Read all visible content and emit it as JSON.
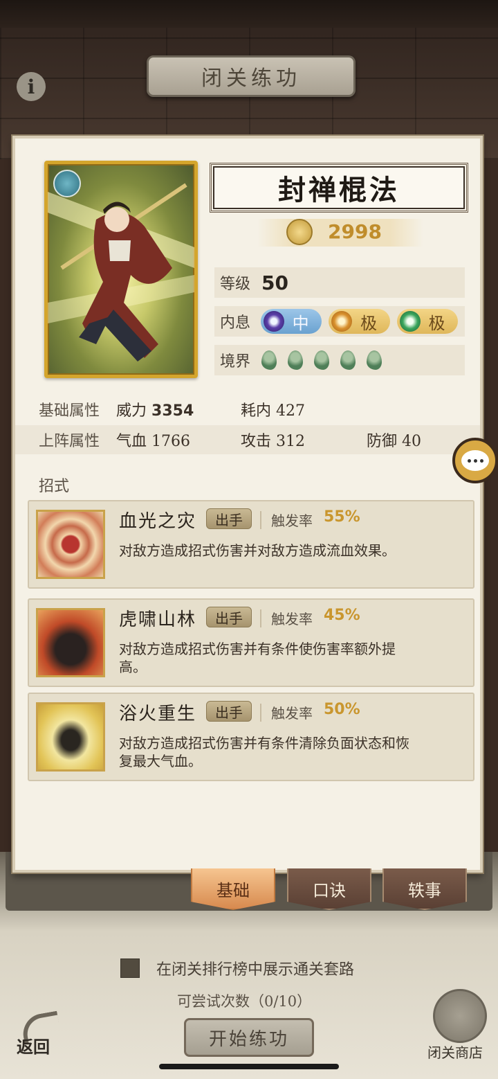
{
  "header": {
    "title": "闭关练功"
  },
  "skill_card": {
    "name": "封禅棍法",
    "power": "2998",
    "level_label": "等级",
    "level_value": "50",
    "inner_label": "内息",
    "inner_pills": [
      "中",
      "极",
      "极"
    ],
    "realm_label": "境界",
    "realm_count": 5
  },
  "attributes": {
    "base_label": "基础属性",
    "base": [
      {
        "key": "威力",
        "value": "3354"
      },
      {
        "key": "耗内",
        "value": "427"
      }
    ],
    "battle_label": "上阵属性",
    "battle": [
      {
        "key": "气血",
        "value": "1766"
      },
      {
        "key": "攻击",
        "value": "312"
      },
      {
        "key": "防御",
        "value": "40"
      }
    ]
  },
  "moves_label": "招式",
  "moves": [
    {
      "name": "血光之灾",
      "tag": "出手",
      "rate_label": "触发率",
      "rate": "55%",
      "desc": "对敌方造成招式伤害并对敌方造成流血效果。"
    },
    {
      "name": "虎啸山林",
      "tag": "出手",
      "rate_label": "触发率",
      "rate": "45%",
      "desc": "对敌方造成招式伤害并有条件使伤害率额外提高。"
    },
    {
      "name": "浴火重生",
      "tag": "出手",
      "rate_label": "触发率",
      "rate": "50%",
      "desc": "对敌方造成招式伤害并有条件清除负面状态和恢复最大气血。"
    }
  ],
  "tabs": [
    "基础",
    "口诀",
    "轶事"
  ],
  "bottom": {
    "checkbox_label": "在闭关排行榜中展示通关套路",
    "attempts": "可尝试次数（0/10）",
    "start_button": "开始练功",
    "back_label": "返回",
    "shop_label": "闭关商店"
  },
  "colors": {
    "accent": "#d4a52c",
    "rate": "#c9962e",
    "active_tab": "#d78a4f"
  }
}
